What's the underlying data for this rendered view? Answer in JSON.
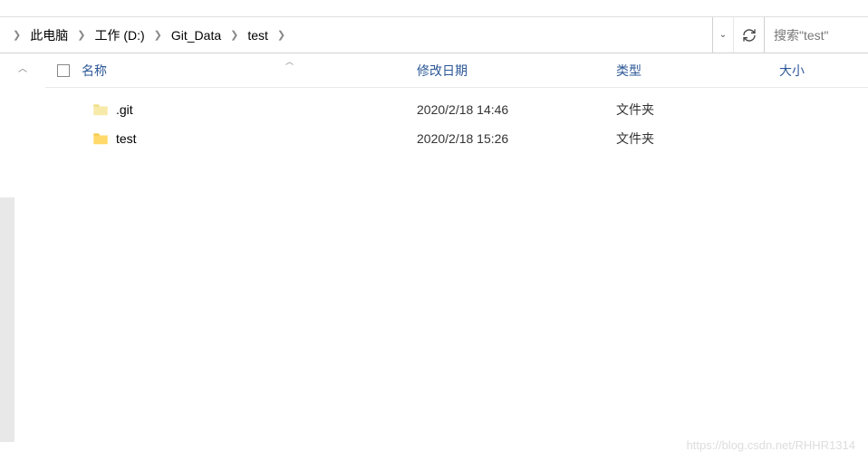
{
  "breadcrumb": {
    "items": [
      {
        "label": "此电脑"
      },
      {
        "label": "工作 (D:)"
      },
      {
        "label": "Git_Data"
      },
      {
        "label": "test"
      }
    ]
  },
  "search": {
    "placeholder": "搜索\"test\""
  },
  "columns": {
    "name": "名称",
    "date": "修改日期",
    "type": "类型",
    "size": "大小"
  },
  "files": [
    {
      "name": ".git",
      "date": "2020/2/18 14:46",
      "type": "文件夹",
      "hidden": true
    },
    {
      "name": "test",
      "date": "2020/2/18 15:26",
      "type": "文件夹",
      "hidden": false
    }
  ],
  "watermark": "https://blog.csdn.net/RHHR1314"
}
